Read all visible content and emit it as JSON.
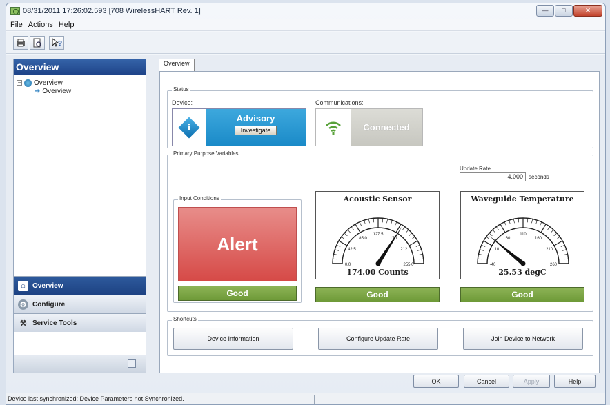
{
  "window": {
    "title": "08/31/2011 17:26:02.593 [708 WirelessHART Rev. 1]"
  },
  "menu": [
    "File",
    "Actions",
    "Help"
  ],
  "nav": {
    "header": "Overview",
    "tree": {
      "root": "Overview",
      "child": "Overview"
    },
    "buttons": [
      "Overview",
      "Configure",
      "Service Tools"
    ]
  },
  "tab": "Overview",
  "status": {
    "title": "Status",
    "device_label": "Device:",
    "device_state": "Advisory",
    "investigate": "Investigate",
    "comm_label": "Communications:",
    "comm_state": "Connected"
  },
  "ppv": {
    "title": "Primary Purpose Variables",
    "update_rate_label": "Update Rate",
    "update_rate_value": "4.000",
    "update_rate_unit": "seconds",
    "input_title": "Input Conditions",
    "input_state": "Alert",
    "input_status": "Good",
    "gauges": [
      {
        "title": "Acoustic Sensor",
        "reading": "174.00 Counts",
        "status": "Good",
        "value": 174,
        "min": 0,
        "max": 255,
        "ticks": [
          "0.0",
          "42.5",
          "85.0",
          "127.5",
          "170",
          "212.",
          "255.0"
        ]
      },
      {
        "title": "Waveguide Temperature",
        "reading": "25.53 degC",
        "status": "Good",
        "value": 25.53,
        "min": -40,
        "max": 260,
        "ticks": [
          "-40",
          "10",
          "60",
          "110",
          "160",
          "210",
          "260"
        ]
      }
    ]
  },
  "shortcuts": {
    "title": "Shortcuts",
    "buttons": [
      "Device Information",
      "Configure Update Rate",
      "Join Device to Network"
    ]
  },
  "dialog_buttons": {
    "ok": "OK",
    "cancel": "Cancel",
    "apply": "Apply",
    "help": "Help"
  },
  "statusbar": "Device last synchronized: Device Parameters not Synchronized."
}
